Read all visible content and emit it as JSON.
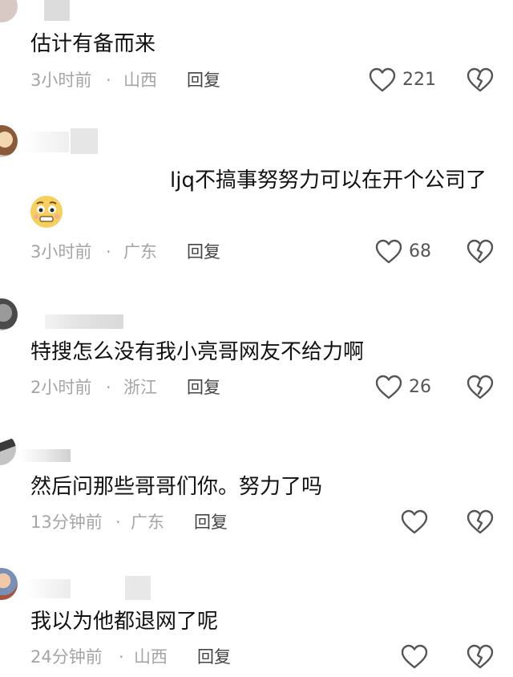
{
  "comments": [
    {
      "text": "估计有备而来",
      "time": "3小时前",
      "dot": "·",
      "location": "山西",
      "reply": "回复",
      "likes": "221",
      "like_icon": "heart-outline-icon",
      "dislike_icon": "broken-heart-icon"
    },
    {
      "text": "ljq不搞事努努力可以在开个公司了",
      "emoji": "worried-face-emoji",
      "time": "3小时前",
      "dot": "·",
      "location": "广东",
      "reply": "回复",
      "likes": "68",
      "like_icon": "heart-outline-icon",
      "dislike_icon": "broken-heart-icon"
    },
    {
      "text": "特搜怎么没有我小亮哥网友不给力啊",
      "time": "2小时前",
      "dot": "·",
      "location": "浙江",
      "reply": "回复",
      "likes": "26",
      "like_icon": "heart-outline-icon",
      "dislike_icon": "broken-heart-icon"
    },
    {
      "text": "然后问那些哥哥们你。努力了吗",
      "time": "13分钟前",
      "dot": "·",
      "location": "广东",
      "reply": "回复",
      "like_icon": "heart-outline-icon",
      "dislike_icon": "broken-heart-icon"
    },
    {
      "text": "我以为他都退网了呢",
      "time": "24分钟前",
      "dot": "·",
      "location": "山西",
      "reply": "回复",
      "like_icon": "heart-outline-icon",
      "dislike_icon": "broken-heart-icon"
    }
  ],
  "colors": {
    "text": "#111111",
    "meta": "#a5a5a5",
    "icon": "#555555",
    "blur": "#e6e6e6"
  }
}
